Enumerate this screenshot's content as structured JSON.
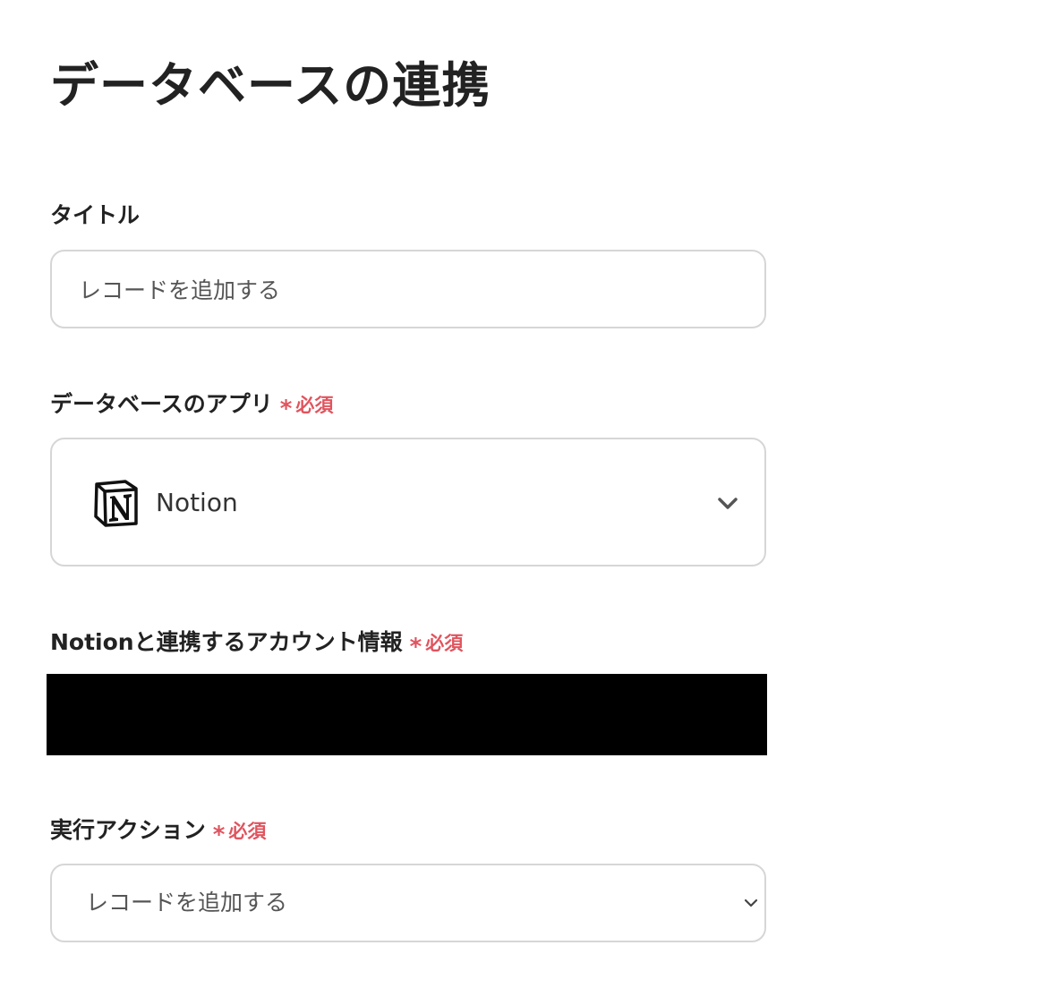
{
  "page": {
    "title": "データベースの連携"
  },
  "fields": {
    "title": {
      "label": "タイトル",
      "value": "レコードを追加する"
    },
    "database_app": {
      "label": "データベースのアプリ",
      "required_mark": "*",
      "required_text": "必須",
      "selected_value": "Notion",
      "icon": "notion-logo-icon"
    },
    "account_info": {
      "label": "Notionと連携するアカウント情報",
      "required_mark": "*",
      "required_text": "必須"
    },
    "action": {
      "label": "実行アクション",
      "required_mark": "*",
      "required_text": "必須",
      "selected_value": "レコードを追加する"
    }
  },
  "colors": {
    "required": "#e0545e",
    "border": "#d6d6d6",
    "text": "#222222",
    "redaction": "#000000"
  }
}
